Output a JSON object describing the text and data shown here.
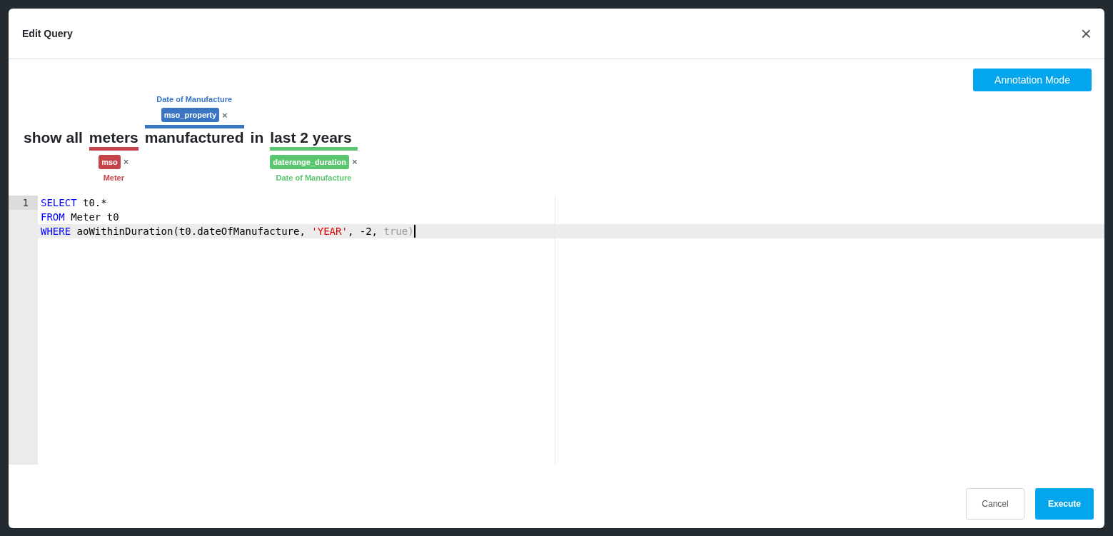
{
  "dialog": {
    "title": "Edit Query",
    "close_icon": "×"
  },
  "annotation_button": "Annotation Mode",
  "sentence": [
    {
      "text": "show all"
    },
    {
      "text": "meters",
      "annotation": {
        "kind": "below",
        "tag": "mso",
        "label": "Meter",
        "color": "#c6434a",
        "remove": "×"
      }
    },
    {
      "text": "manufactured",
      "annotation": {
        "kind": "above",
        "tag": "mso_property",
        "label": "Date of Manufacture",
        "color": "#3a75c4",
        "remove": "×"
      }
    },
    {
      "text": "in"
    },
    {
      "text": "last 2 years",
      "annotation": {
        "kind": "below",
        "tag": "daterange_duration",
        "label": "Date of Manufacture",
        "color": "#5cc56f",
        "remove": "×"
      }
    }
  ],
  "editor": {
    "lines": [
      {
        "number": "1",
        "active": false,
        "tokens": [
          {
            "kind": "keyword",
            "text": "SELECT"
          },
          {
            "kind": "plain",
            "text": " t0.*"
          }
        ]
      },
      {
        "active": false,
        "tokens": [
          {
            "kind": "keyword",
            "text": "FROM"
          },
          {
            "kind": "plain",
            "text": " Meter t0"
          }
        ]
      },
      {
        "active": true,
        "tokens": [
          {
            "kind": "keyword",
            "text": "WHERE"
          },
          {
            "kind": "plain",
            "text": " aoWithinDuration(t0.dateOfManufacture, "
          },
          {
            "kind": "string",
            "text": "'YEAR'"
          },
          {
            "kind": "plain",
            "text": ", -2, "
          },
          {
            "kind": "muted",
            "text": "true)"
          }
        ]
      }
    ]
  },
  "buttons": [
    {
      "label": "Cancel",
      "kind": "secondary"
    },
    {
      "label": "Execute",
      "kind": "primary"
    }
  ]
}
